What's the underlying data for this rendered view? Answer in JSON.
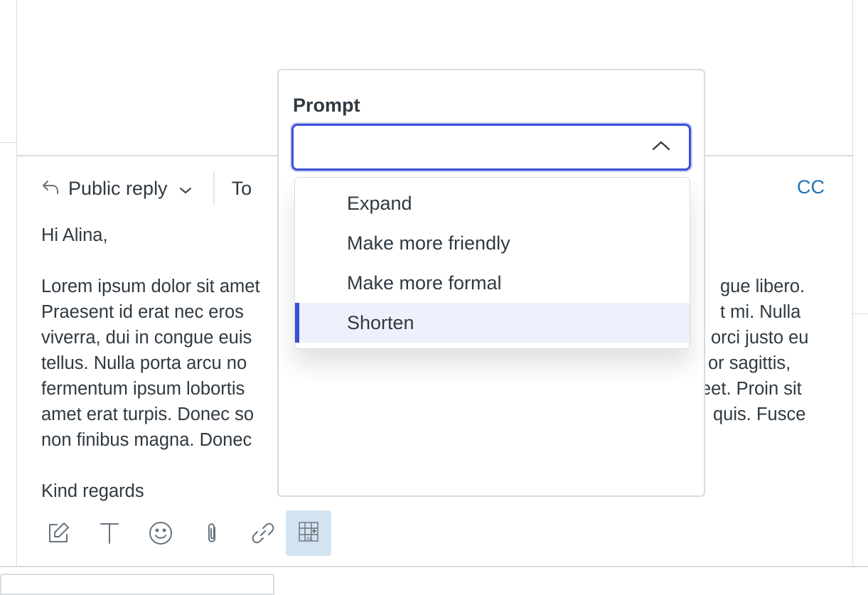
{
  "reply": {
    "type_label": "Public reply",
    "to_label": "To",
    "cc_label": "CC"
  },
  "message": {
    "greeting": "Hi Alina,",
    "lines": [
      "Lorem ipsum dolor sit amet",
      "Praesent id erat nec eros",
      "viverra, dui in congue euis",
      "tellus. Nulla porta arcu no",
      "fermentum ipsum lobortis",
      "amet erat turpis. Donec so",
      "non finibus magna. Donec"
    ],
    "lines_right": [
      "gue libero.",
      "t mi. Nulla",
      "orci justo eu",
      "or sagittis,",
      "eet. Proin sit",
      "quis. Fusce",
      ""
    ],
    "signoff": "Kind regards"
  },
  "prompt_panel": {
    "label": "Prompt",
    "selected_value": "",
    "options": [
      "Expand",
      "Make more friendly",
      "Make more formal",
      "Shorten"
    ],
    "active_option": "Shorten"
  },
  "toolbar": {
    "icons": [
      "compose-icon",
      "text-format-icon",
      "emoji-icon",
      "attachment-icon",
      "link-icon",
      "ai-assist-icon"
    ]
  },
  "colors": {
    "accent": "#3c50d6",
    "link": "#1f73b7",
    "text": "#2f3941",
    "border": "#d8dcde",
    "ai_button_bg": "#d3e3ef",
    "active_option_bg": "#eef0fb"
  }
}
